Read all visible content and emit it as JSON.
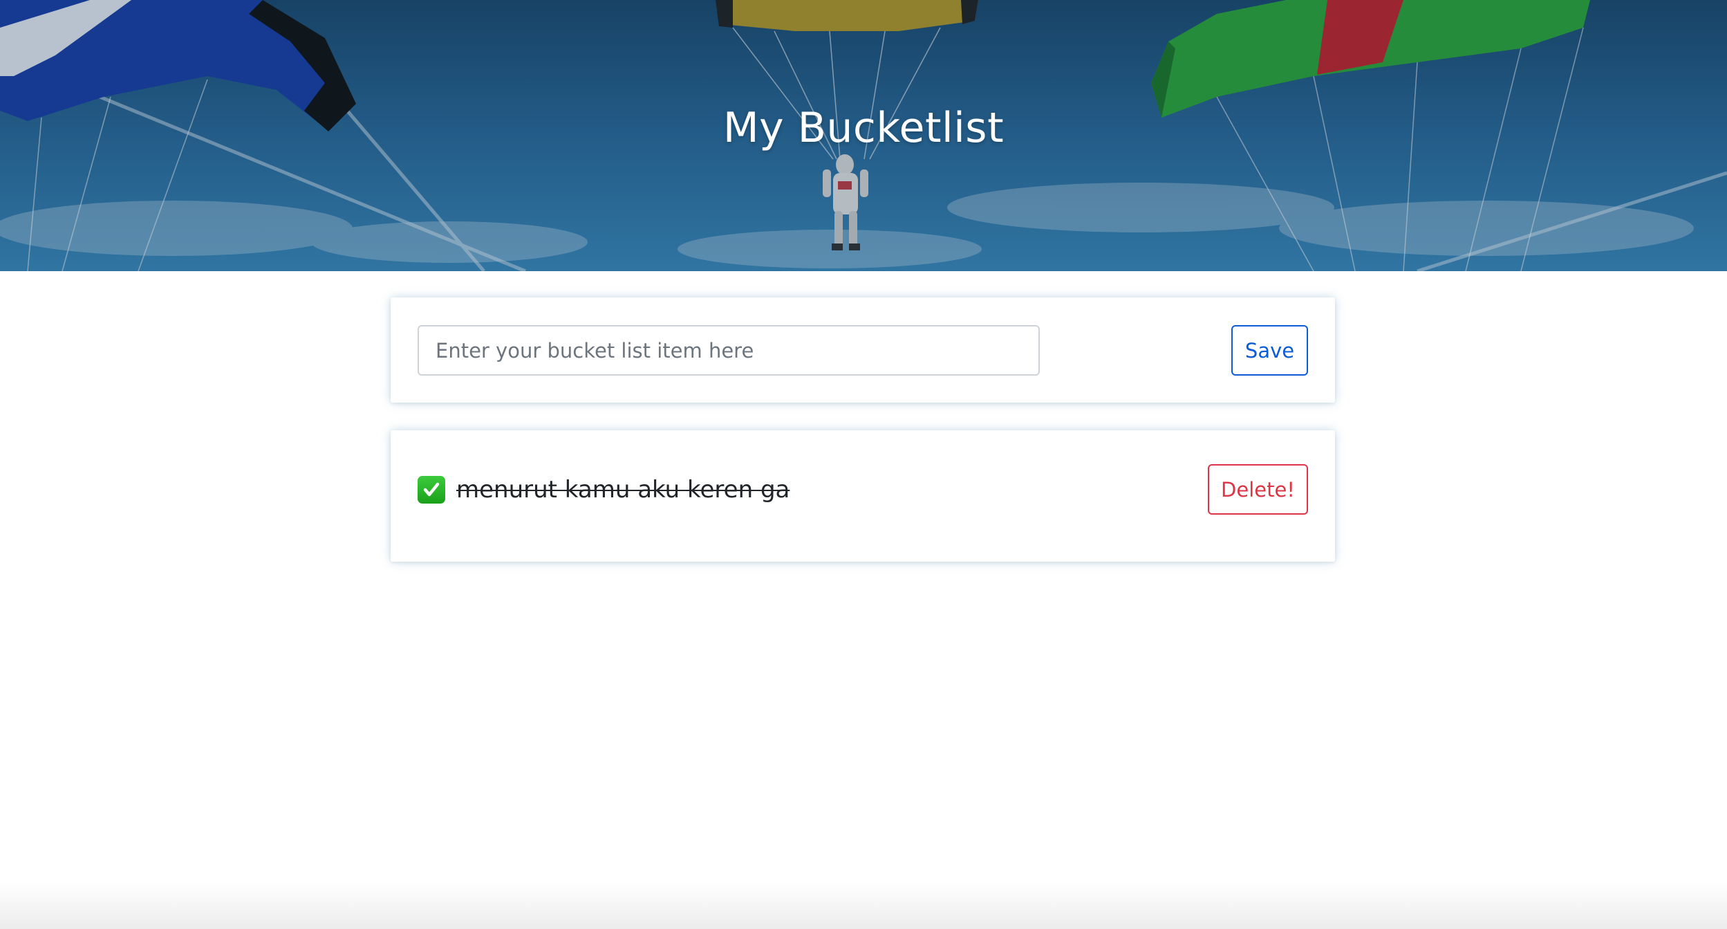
{
  "header": {
    "title": "My Bucketlist"
  },
  "form": {
    "input_placeholder": "Enter your bucket list item here",
    "input_value": "",
    "save_label": "Save"
  },
  "items": [
    {
      "text": "menurut kamu aku keren ga",
      "done": true,
      "icon": "check-mark-icon",
      "delete_label": "Delete!"
    }
  ],
  "colors": {
    "primary": "#0d5bd7",
    "danger": "#dc3545",
    "done_green": "#1aa01a"
  }
}
